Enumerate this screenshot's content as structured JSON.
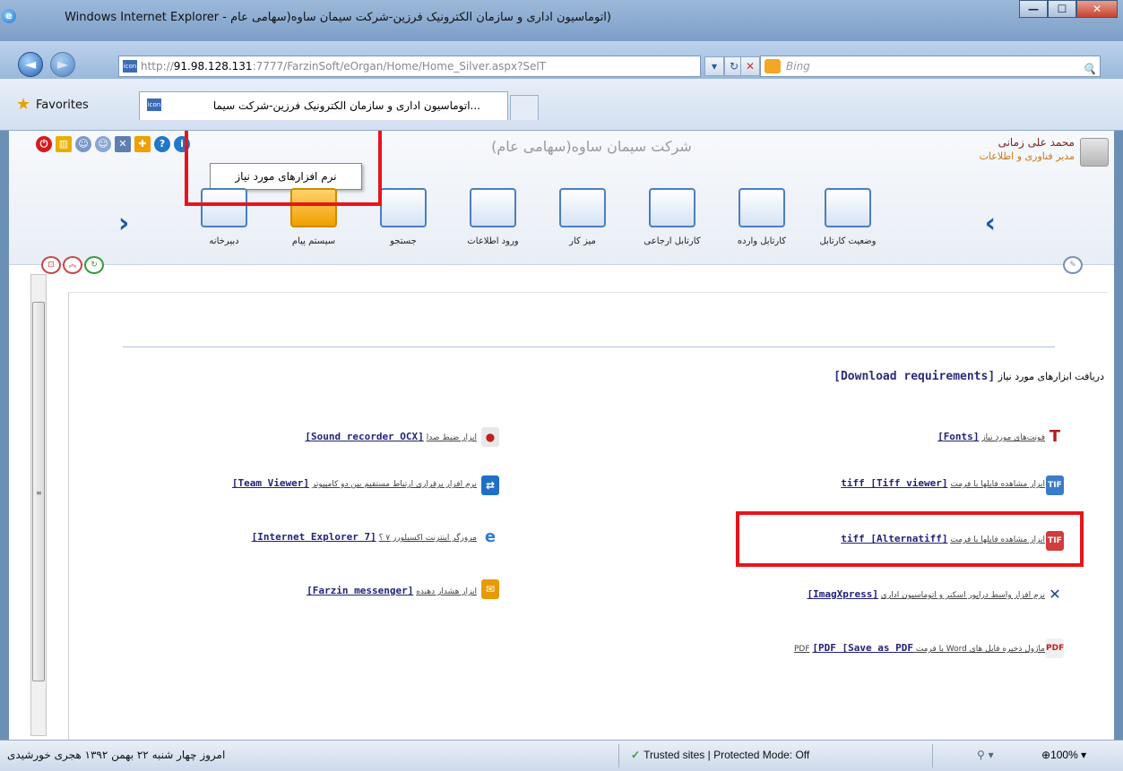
{
  "window": {
    "title": "(اتوماسیون اداری و سازمان الکترونیک فرزین-شرکت سیمان ساوه(سهامی عام - Windows Internet Explorer",
    "ie_logo": "e",
    "minimize": "—",
    "maximize": "☐",
    "close": "✕"
  },
  "nav": {
    "back_icon": "◄",
    "forward_icon": "►",
    "address_prefix": "http://",
    "address_host": "91.98.128.131",
    "address_rest": ":7777/FarzinSoft/eOrgan/Home/Home_Silver.aspx?SelT",
    "addr_icon_text": "icon",
    "search_placeholder": "Bing",
    "search_icon": "🔍"
  },
  "favorites": {
    "label": "Favorites",
    "tab_title": "...اتوماسیون اداری و سازمان الکترونیک فرزین-شرکت سیما",
    "tab_icon_text": "icon"
  },
  "header": {
    "user_name": "محمد علی زمانی",
    "user_role": "مدیر فناوری و اطلاعات",
    "company": "شرکت سیمان ساوه(سهامی عام)",
    "tooltip": "نرم افزارهای مورد نیاز"
  },
  "toolbar": {
    "items": [
      {
        "label": "وضعیت کارتابل"
      },
      {
        "label": "کارتابل وارده"
      },
      {
        "label": "کارتابل ارجاعی"
      },
      {
        "label": "میز کار"
      },
      {
        "label": "ورود اطلاعات"
      },
      {
        "label": "جستجو"
      },
      {
        "label": "سیستم پیام"
      },
      {
        "label": "دبیرخانه"
      }
    ],
    "nav_right": "‹",
    "nav_left": "›"
  },
  "content": {
    "title_fa": "دریافت ابزارهای مورد نیاز",
    "title_en": "[Download requirements]",
    "right_items": [
      {
        "fa": "فونت‌های مورد نیاز",
        "en": "[Fonts]"
      },
      {
        "fa": "ابزار مشاهده فایلها با فرمت",
        "en": "[tiff [Tiff viewer"
      },
      {
        "fa": "ابزار مشاهده فایلها با فرمت",
        "en": "[tiff [Alternatiff"
      },
      {
        "fa": "نرم افزار واسط درایور اسکنر و اتوماسیون اداری",
        "en": "[ImagXpress]"
      },
      {
        "fa": "ماژول ذخیره فایل های Word با فرمت PDF",
        "en": "[PDF [Save as PDF"
      }
    ],
    "left_items": [
      {
        "fa": "ابزار ضبط صدا",
        "en": "[Sound recorder OCX]"
      },
      {
        "fa": "نرم افزار برقراری ارتباط مستقیم بین دو کامپیوتر",
        "en": "[Team Viewer]"
      },
      {
        "fa": "مرورگر اینترنت اکسپلورر ۷ ؟",
        "en": "[Internet Explorer 7]"
      },
      {
        "fa": "ابزار هشدار دهنده",
        "en": "[Farzin messenger]"
      }
    ]
  },
  "status": {
    "date": "امروز چهار شنبه ۲۲ بهمن ۱۳۹۲ هجری خورشیدی",
    "zone": "Trusted sites | Protected Mode: Off",
    "zoom": "100%",
    "check": "✓"
  },
  "colors": {
    "highlight": "#e8141b",
    "link": "#22227a"
  }
}
